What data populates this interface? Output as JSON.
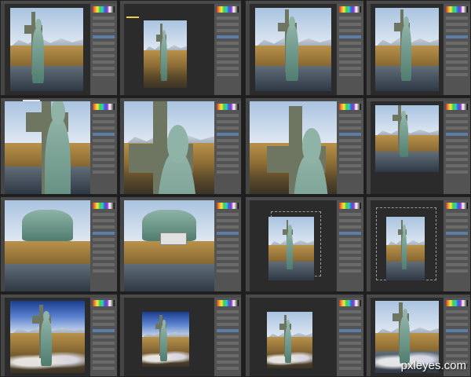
{
  "collage": {
    "rows": 4,
    "cols": 4,
    "tiles": [
      {
        "id": "r1c1",
        "scene": "field-statue-blended"
      },
      {
        "id": "r1c2",
        "scene": "statue-cutout-on-canvas"
      },
      {
        "id": "r1c3",
        "scene": "statue-in-field"
      },
      {
        "id": "r1c4",
        "scene": "statue-in-field-full"
      },
      {
        "id": "r2c1",
        "scene": "statue-base-closeup"
      },
      {
        "id": "r2c2",
        "scene": "statue-head-closeup"
      },
      {
        "id": "r2c3",
        "scene": "cross-closeup"
      },
      {
        "id": "r2c4",
        "scene": "statue-reflection"
      },
      {
        "id": "r3c1",
        "scene": "feet-closeup"
      },
      {
        "id": "r3c2",
        "scene": "feet-closeup-dialog"
      },
      {
        "id": "r3c3",
        "scene": "statue-on-canvas-small"
      },
      {
        "id": "r3c4",
        "scene": "statue-on-canvas-selection"
      },
      {
        "id": "r4c1",
        "scene": "blue-sky-statue"
      },
      {
        "id": "r4c2",
        "scene": "blue-sky-statue-canvas"
      },
      {
        "id": "r4c3",
        "scene": "cloudy-statue-canvas"
      },
      {
        "id": "r4c4",
        "scene": "final-composite"
      }
    ]
  },
  "colors": {
    "panel": "#535353",
    "canvas_bg": "#2b2b2b",
    "workspace": "#3c3c3c",
    "statue": "#6f9e8f",
    "selected_layer": "#5b7ea8"
  },
  "watermark": {
    "text": "pxleyes.com"
  }
}
